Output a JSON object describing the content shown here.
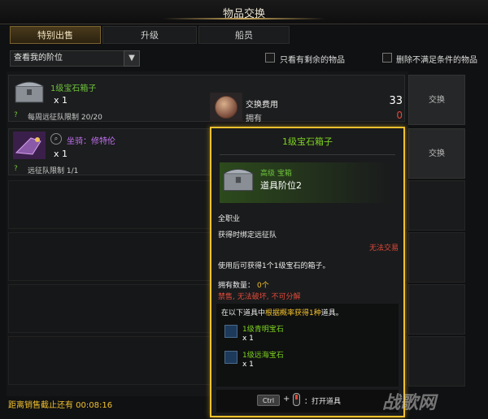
{
  "window": {
    "title": "物品交换"
  },
  "tabs": [
    {
      "label": "特别出售",
      "active": true
    },
    {
      "label": "升级",
      "active": false
    },
    {
      "label": "船员",
      "active": false
    }
  ],
  "filters": {
    "rank_select": "查看我的阶位",
    "only_with_remaining": "只看有剩余的物品",
    "hide_unmet": "删除不满足条件的物品"
  },
  "items": [
    {
      "name": "1级宝石箱子",
      "qty": "x 1",
      "limit": "每周远征队限制 20/20",
      "button": "交换"
    },
    {
      "name": "坐骑：修特伦",
      "qty": "x 1",
      "limit": "远征队限制 1/1",
      "button": "交换"
    }
  ],
  "exchange": {
    "cost_label": "交换费用",
    "cost_value": "33",
    "owned_label": "拥有",
    "owned_value": "0"
  },
  "tooltip": {
    "name": "1级宝石箱子",
    "grade": "高级 宝箱",
    "tier": "道具阶位2",
    "class": "全职业",
    "bind": "获得时绑定远征队",
    "no_trade": "无法交易",
    "usage": "使用后可获得1个1级宝石的箱子。",
    "owned_label": "拥有数量：",
    "owned_value": "0个",
    "ban_parts": [
      "禁售",
      "无法破坏",
      "不可分解"
    ],
    "reward_intro_prefix": "在以下道具中",
    "reward_intro_highlight": "根据概率获得1种",
    "reward_intro_suffix": "道具。",
    "rewards": [
      {
        "name": "1级青明宝石",
        "qty": "x 1"
      },
      {
        "name": "1级远海宝石",
        "qty": "x 1"
      }
    ],
    "ctrl_key": "Ctrl",
    "plus": "+",
    "open_label": "：打开道具"
  },
  "footer": {
    "deadline": "距离销售截止还有 00:08:16"
  },
  "watermark": "战歌网",
  "colors": {
    "accent": "#f2c12e",
    "grade_green": "#6ec23c",
    "warning_red": "#e04a3a"
  }
}
